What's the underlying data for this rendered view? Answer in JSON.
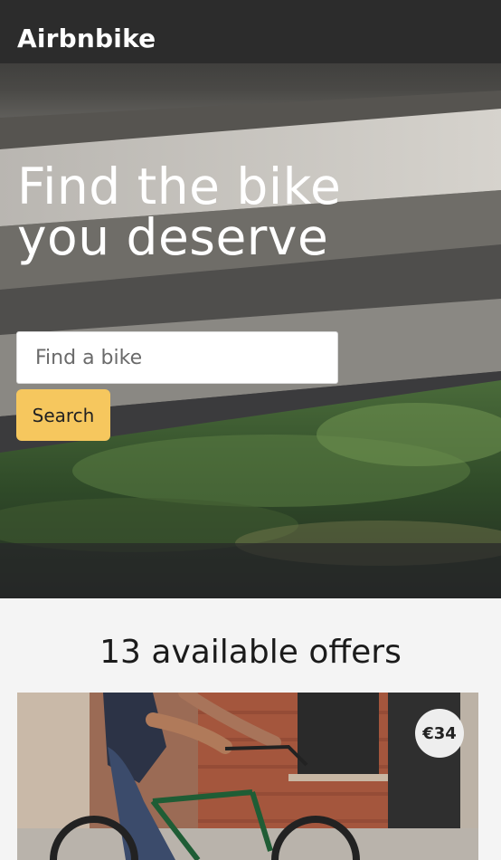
{
  "header": {
    "logo": "Airbnbike"
  },
  "hero": {
    "headline_line1": "Find the bike",
    "headline_line2": "you deserve",
    "search_placeholder": "Find a bike",
    "search_button": "Search"
  },
  "offers": {
    "title": "13 available offers",
    "items": [
      {
        "price": "€34"
      }
    ]
  },
  "colors": {
    "accent": "#f6c75e",
    "hero_text": "#ffffff",
    "page_background": "#f4f4f4"
  }
}
